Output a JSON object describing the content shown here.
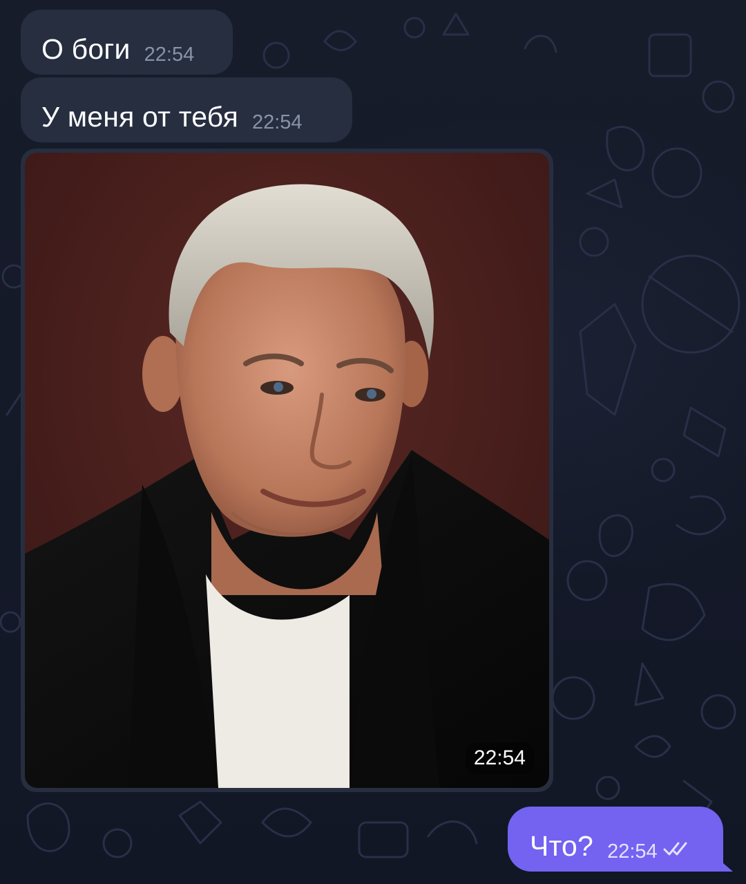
{
  "messages": [
    {
      "id": "m1",
      "direction": "incoming",
      "type": "text",
      "text": "О боги",
      "time": "22:54"
    },
    {
      "id": "m2",
      "direction": "incoming",
      "type": "text",
      "text": "У меня от тебя",
      "time": "22:54"
    },
    {
      "id": "m3",
      "direction": "incoming",
      "type": "photo",
      "time": "22:54"
    },
    {
      "id": "m4",
      "direction": "outgoing",
      "type": "text",
      "text": "Что?",
      "time": "22:54",
      "status": "read",
      "status_icon": "double-check-icon"
    }
  ],
  "theme": {
    "background": "#151a29",
    "incoming_bubble": "#262e40",
    "outgoing_bubble": "#7363f0",
    "text": "#ffffff",
    "time_muted": "#8a93a8",
    "photo_backdrop": "#4a1f1d"
  }
}
